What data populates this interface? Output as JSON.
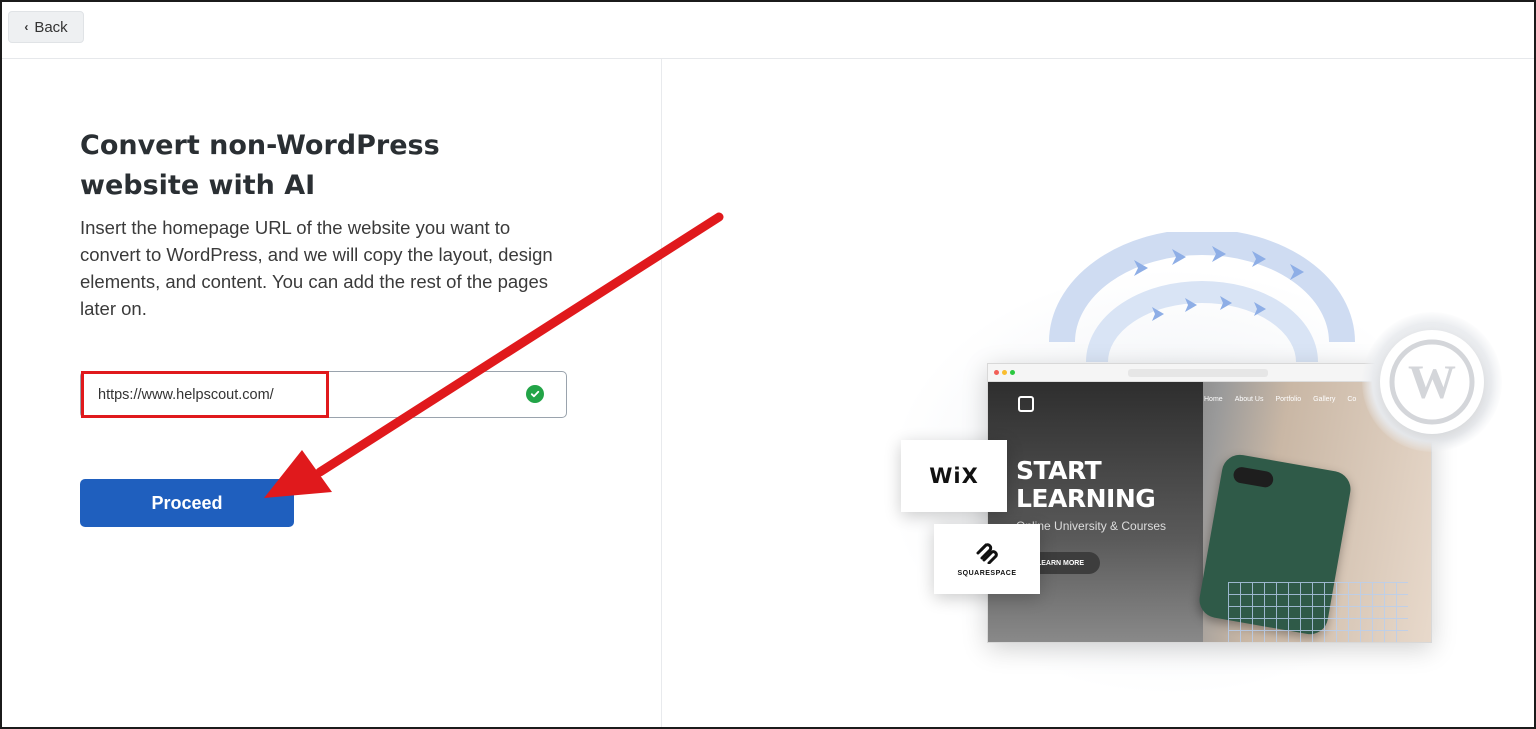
{
  "topbar": {
    "back_label": "Back"
  },
  "main": {
    "title": "Convert non-WordPress website with AI",
    "description": "Insert the homepage URL of the website you want to convert to WordPress, and we will copy the layout, design elements, and content. You can add the rest of the pages later on.",
    "url_input": {
      "value": "https://www.helpscout.com/",
      "status_icon": "check-circle-icon",
      "status_color": "#22a447"
    },
    "proceed_label": "Proceed",
    "accent_color": "#1f5fbe"
  },
  "annotation": {
    "arrow_color": "#e0191c",
    "highlight_color": "#e0191c"
  },
  "illustration": {
    "browser_nav": [
      "Home",
      "About Us",
      "Portfolio",
      "Gallery",
      "Co"
    ],
    "hero_title_line1": "START",
    "hero_title_line2": "LEARNING",
    "hero_subtitle": "Online University & Courses",
    "hero_button": "LEARN MORE",
    "wix_label": "WiX",
    "squarespace_label": "SQUARESPACE"
  }
}
